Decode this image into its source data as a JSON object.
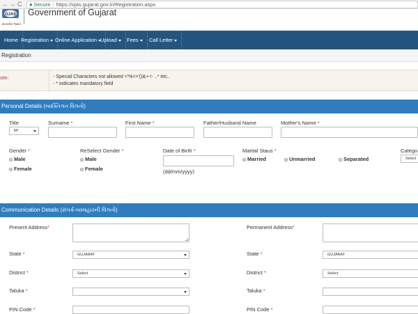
{
  "browser": {
    "secure_label": "Secure",
    "url": "https://ojas.gujarat.gov.in/Registration.aspx",
    "back_icon": "←",
    "forward_icon": "→",
    "reload_icon": "C",
    "lock_icon": "🔒"
  },
  "header": {
    "logo_text": "OJAS",
    "logo_subtext": "સત્યમેવ જયતે",
    "title": "Government of Gujarat"
  },
  "menu": {
    "items": [
      {
        "label": "Home",
        "has_caret": false
      },
      {
        "label": "Registration",
        "has_caret": true
      },
      {
        "label": "Online Application",
        "has_caret": true
      },
      {
        "label": "Upload",
        "has_caret": true
      },
      {
        "label": "Fees",
        "has_caret": true
      },
      {
        "label": "Call Letter",
        "has_caret": true
      }
    ]
  },
  "registration_header": "Registration",
  "note": {
    "label": "ote:",
    "lines": [
      "- Special Characters not allowed <'%<>'()&+-!- ..* etc..",
      "- * indicates mandatory field"
    ]
  },
  "personal": {
    "section_title": "Personal Details (વ્યક્તિગત વિગતો)",
    "title_label": "Title",
    "title_value": "Mr",
    "surname_label": "Surname",
    "first_name_label": "First Name",
    "father_label": "Father/Husband Name",
    "mother_label": "Mother's Name",
    "gender_label": "Gender",
    "gender_options": [
      "Male",
      "Female"
    ],
    "reselect_gender_label": "ReSelect Gender",
    "reselect_options": [
      "Male",
      "Female"
    ],
    "dob_label": "Date of Birth",
    "dob_hint": "(dd/mm/yyyy)",
    "marital_label": "Marital Staus",
    "marital_options": [
      "Married",
      "Unmarried",
      "Separated"
    ],
    "category_label": "Catego",
    "category_value": "Select"
  },
  "communication": {
    "section_title": "Communication Details (સંપર્ક-વ્યવહારની વિગતો)",
    "present_address_label": "Present Address",
    "permanent_address_label": "Permanent Address",
    "state_label": "State",
    "state_value_present": "GUJARAT",
    "state_value_permanent": "GUJARAT",
    "district_label": "District",
    "district_value_present": "Select",
    "district_value_permanent": "Select",
    "taluka_label": "Taluka",
    "pin_label": "PIN Code",
    "required_mark": "*"
  },
  "colors": {
    "menu_bg": "#245580",
    "section_bg": "#2f7dbf",
    "note_label": "#a94442",
    "secure_green": "#0b8043"
  }
}
